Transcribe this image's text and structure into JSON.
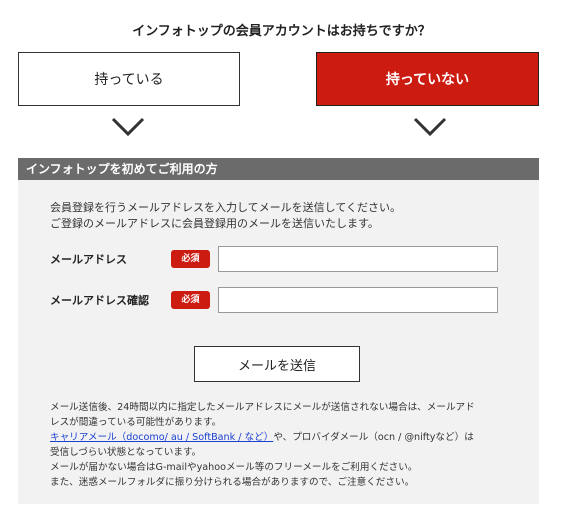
{
  "question": "インフォトップの会員アカウントはお持ちですか？",
  "choices": {
    "have": "持っている",
    "dont_have": "持っていない"
  },
  "icons": {
    "left_chevron": "chevron-down-icon",
    "right_chevron": "chevron-down-icon"
  },
  "colors": {
    "accent": "#cc1b10",
    "section_header": "#6b6b6b",
    "section_bg": "#f2f2f2",
    "link": "#1a3fd1"
  },
  "section": {
    "title": "インフォトップを初めてご利用の方",
    "intro_line1": "会員登録を行うメールアドレスを入力してメールを送信してください。",
    "intro_line2": "ご登録のメールアドレスに会員登録用のメールを送信いたします。",
    "email_label": "メールアドレス",
    "email_confirm_label": "メールアドレス確認",
    "required_badge": "必須",
    "email_value": "",
    "email_confirm_value": "",
    "submit_label": "メールを送信",
    "notes": {
      "line1": "メール送信後、24時間以内に指定したメールアドレスにメールが送信されない場合は、メールアド",
      "line2": "レスが間違っている可能性があります。",
      "line3_link": "キャリアメール（docomo/ au / SoftBank / など）",
      "line3_rest": "や、プロバイダメール（ocn / @niftyなど）は",
      "line4": "受信しづらい状態となっています。",
      "line5": "メールが届かない場合はG-mailやyahooメール等のフリーメールをご利用ください。",
      "line6": "また、迷惑メールフォルダに振り分けられる場合がありますので、ご注意ください。"
    }
  }
}
